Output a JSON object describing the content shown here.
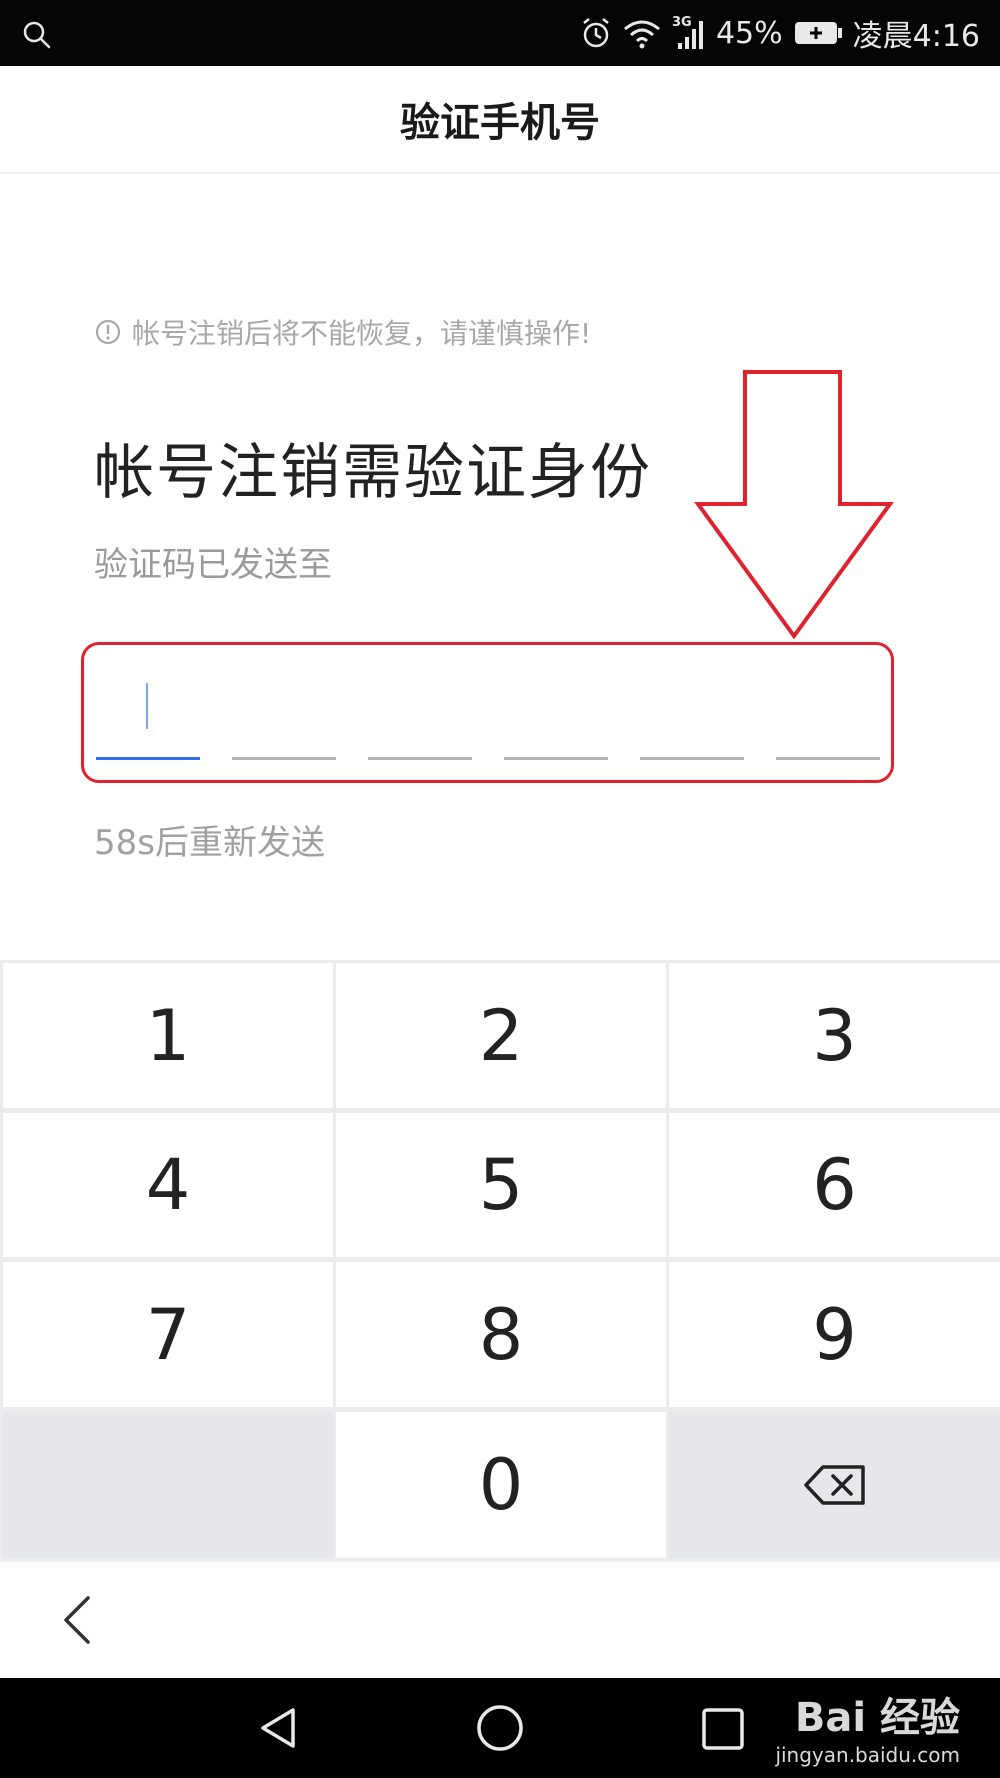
{
  "status_bar": {
    "battery_pct": "45%",
    "clock": "凌晨4:16",
    "network": "3G",
    "icons": [
      "search-icon",
      "alarm-icon",
      "wifi-icon",
      "signal-icon",
      "battery-icon"
    ]
  },
  "header": {
    "title": "验证手机号"
  },
  "main": {
    "warning": "帐号注销后将不能恢复，请谨慎操作!",
    "heading": "帐号注销需验证身份",
    "sent_to": "验证码已发送至",
    "code_digits": [
      "",
      "",
      "",
      "",
      "",
      ""
    ],
    "resend": "58s后重新发送"
  },
  "keypad": {
    "keys": [
      "1",
      "2",
      "3",
      "4",
      "5",
      "6",
      "7",
      "8",
      "9",
      "",
      "0",
      "⌫"
    ]
  },
  "watermark": {
    "main": "Bai  经验",
    "sub": "jingyan.baidu.com"
  },
  "colors": {
    "accent": "#2f6fe8",
    "annotation": "#e0212e",
    "muted": "#a0a0a0"
  }
}
